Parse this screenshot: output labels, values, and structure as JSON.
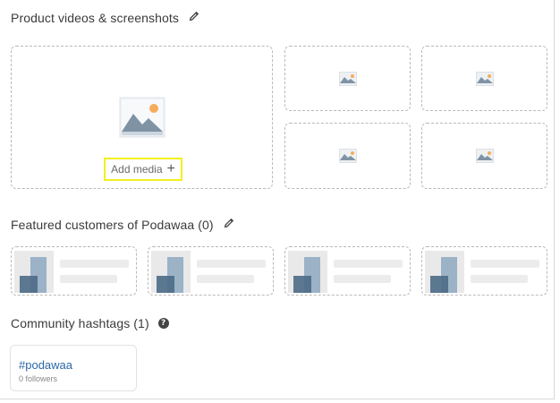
{
  "media_section": {
    "title": "Product videos & screenshots",
    "add_media_label": "Add media",
    "add_media_plus": "+"
  },
  "customers_section": {
    "title": "Featured customers of Podawaa (0)"
  },
  "hashtags_section": {
    "title": "Community hashtags (1)",
    "help_glyph": "?",
    "items": [
      {
        "name": "#podawaa",
        "followers": "0 followers"
      }
    ]
  },
  "colors": {
    "highlight_border": "#f4ef20",
    "link": "#2a67a8"
  }
}
